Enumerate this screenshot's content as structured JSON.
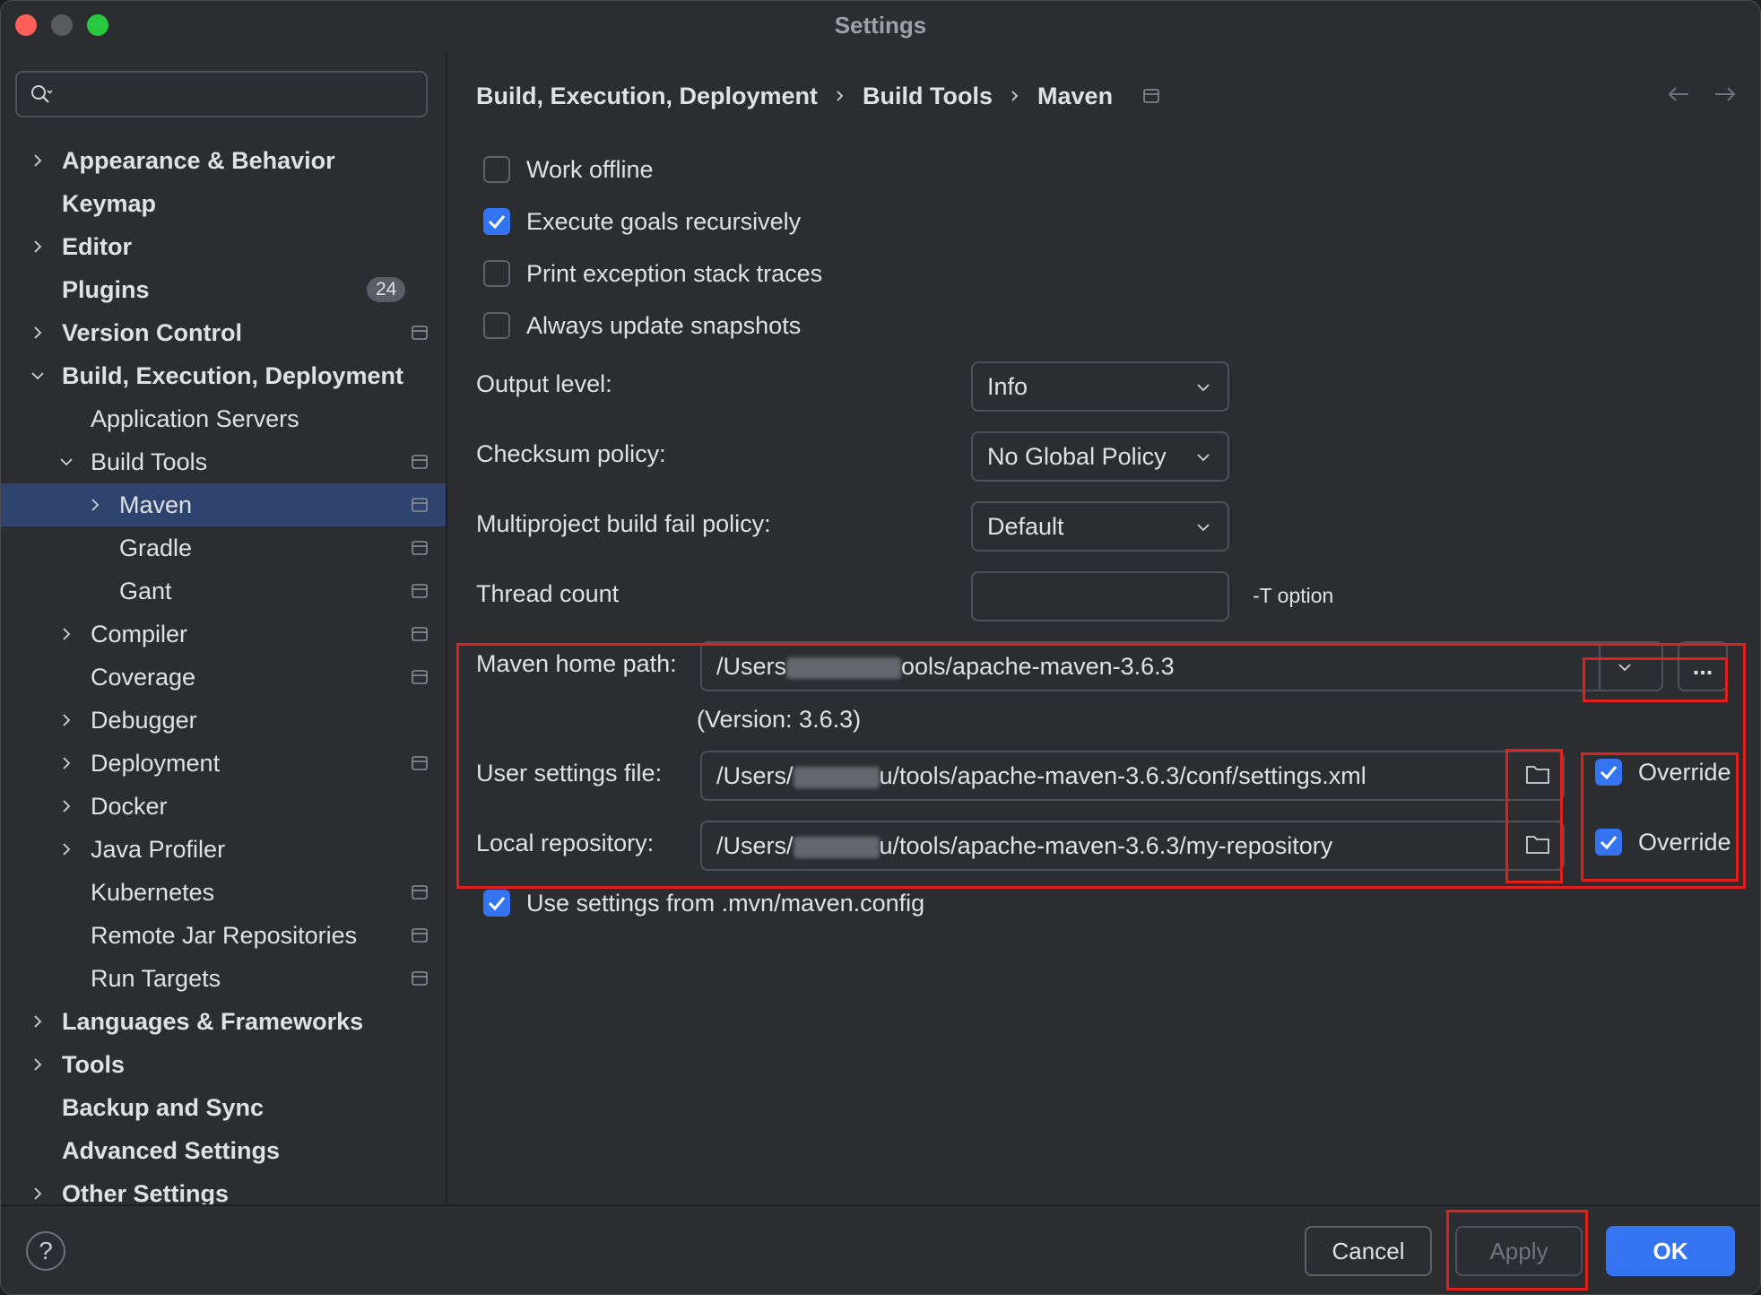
{
  "window": {
    "title": "Settings"
  },
  "search": {
    "placeholder": ""
  },
  "sidebar": {
    "items": [
      {
        "label": "Appearance & Behavior",
        "bold": true
      },
      {
        "label": "Keymap",
        "bold": true
      },
      {
        "label": "Editor",
        "bold": true
      },
      {
        "label": "Plugins",
        "bold": true,
        "badge": "24"
      },
      {
        "label": "Version Control",
        "bold": true
      },
      {
        "label": "Build, Execution, Deployment",
        "bold": true
      },
      {
        "label": "Application Servers"
      },
      {
        "label": "Build Tools"
      },
      {
        "label": "Maven",
        "selected": true
      },
      {
        "label": "Gradle"
      },
      {
        "label": "Gant"
      },
      {
        "label": "Compiler"
      },
      {
        "label": "Coverage"
      },
      {
        "label": "Debugger"
      },
      {
        "label": "Deployment"
      },
      {
        "label": "Docker"
      },
      {
        "label": "Java Profiler"
      },
      {
        "label": "Kubernetes"
      },
      {
        "label": "Remote Jar Repositories"
      },
      {
        "label": "Run Targets"
      },
      {
        "label": "Languages & Frameworks",
        "bold": true
      },
      {
        "label": "Tools",
        "bold": true
      },
      {
        "label": "Backup and Sync",
        "bold": true
      },
      {
        "label": "Advanced Settings",
        "bold": true
      },
      {
        "label": "Other Settings",
        "bold": true
      }
    ]
  },
  "breadcrumb": [
    "Build, Execution, Deployment",
    "Build Tools",
    "Maven"
  ],
  "checkboxes": {
    "work_offline": {
      "label": "Work offline",
      "checked": false
    },
    "execute_goals": {
      "label": "Execute goals recursively",
      "checked": true
    },
    "print_exception": {
      "label": "Print exception stack traces",
      "checked": false
    },
    "always_update": {
      "label": "Always update snapshots",
      "checked": false
    },
    "use_mvn_config": {
      "label": "Use settings from .mvn/maven.config",
      "checked": true
    }
  },
  "fields": {
    "output_level": {
      "label": "Output level:",
      "value": "Info"
    },
    "checksum_policy": {
      "label": "Checksum policy:",
      "value": "No Global Policy"
    },
    "multiproject_policy": {
      "label": "Multiproject build fail policy:",
      "value": "Default"
    },
    "thread_count": {
      "label": "Thread count",
      "value": "",
      "hint": "-T option"
    },
    "maven_home": {
      "label": "Maven home path:",
      "value_prefix": "/Users",
      "value_suffix": "ools/apache-maven-3.6.3",
      "version": "(Version: 3.6.3)",
      "browse_label": "..."
    },
    "user_settings": {
      "label": "User settings file:",
      "value_prefix": "/Users/",
      "value_suffix": "u/tools/apache-maven-3.6.3/conf/settings.xml",
      "override_label": "Override",
      "override_checked": true
    },
    "local_repo": {
      "label": "Local repository:",
      "value_prefix": "/Users/",
      "value_suffix": "u/tools/apache-maven-3.6.3/my-repository",
      "override_label": "Override",
      "override_checked": true
    }
  },
  "footer": {
    "help": "?",
    "cancel": "Cancel",
    "apply": "Apply",
    "ok": "OK"
  },
  "colors": {
    "accent": "#3574f0",
    "selection": "#2e436e",
    "highlight_box": "#e0201c",
    "background": "#2b2d30"
  }
}
